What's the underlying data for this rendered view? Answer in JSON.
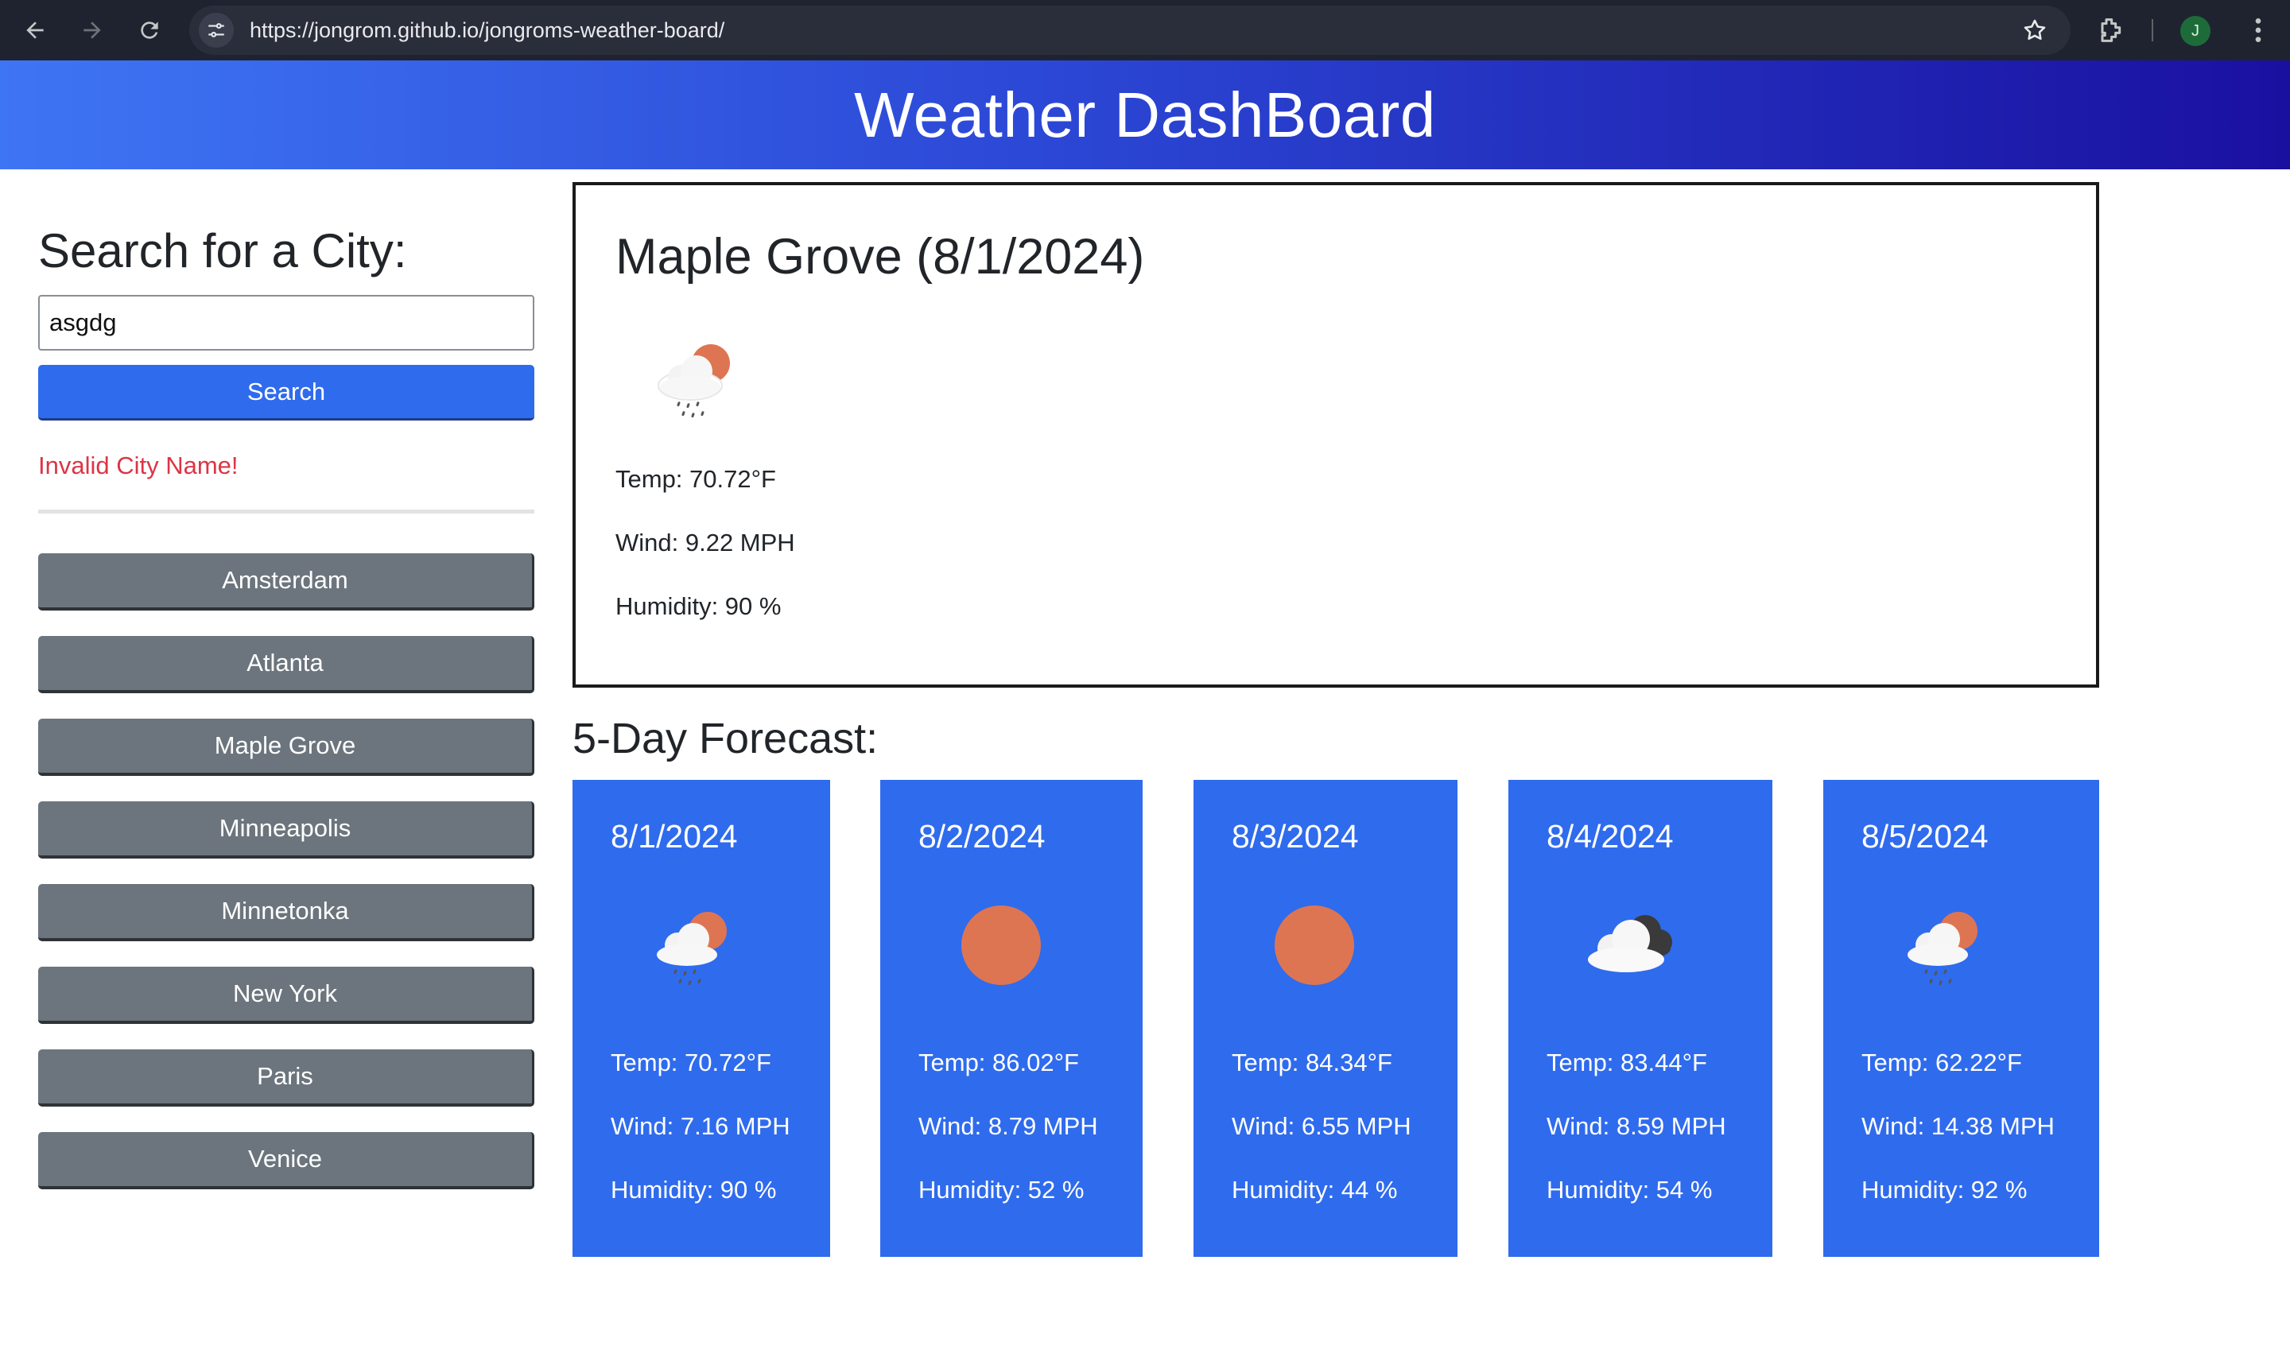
{
  "browser": {
    "url": "https://jongrom.github.io/jongroms-weather-board/",
    "profile_initial": "J"
  },
  "header": {
    "title": "Weather DashBoard"
  },
  "sidebar": {
    "search_title": "Search for a City:",
    "search_value": "asgdg",
    "search_button": "Search",
    "error_message": "Invalid City Name!",
    "history": [
      "Amsterdam",
      "Atlanta",
      "Maple Grove",
      "Minneapolis",
      "Minnetonka",
      "New York",
      "Paris",
      "Venice"
    ]
  },
  "current": {
    "title": "Maple Grove (8/1/2024)",
    "icon": "rain-sun-icon",
    "temp": "Temp: 70.72°F",
    "wind": "Wind: 9.22 MPH",
    "humidity": "Humidity: 90 %"
  },
  "forecast": {
    "title": "5-Day Forecast:",
    "days": [
      {
        "date": "8/1/2024",
        "icon": "rain-sun-icon",
        "temp": "Temp: 70.72°F",
        "wind": "Wind: 7.16 MPH",
        "humidity": "Humidity: 90 %"
      },
      {
        "date": "8/2/2024",
        "icon": "sun-icon",
        "temp": "Temp: 86.02°F",
        "wind": "Wind: 8.79 MPH",
        "humidity": "Humidity: 52 %"
      },
      {
        "date": "8/3/2024",
        "icon": "sun-icon",
        "temp": "Temp: 84.34°F",
        "wind": "Wind: 6.55 MPH",
        "humidity": "Humidity: 44 %"
      },
      {
        "date": "8/4/2024",
        "icon": "cloud-icon",
        "temp": "Temp: 83.44°F",
        "wind": "Wind: 8.59 MPH",
        "humidity": "Humidity: 54 %"
      },
      {
        "date": "8/5/2024",
        "icon": "rain-sun-icon",
        "temp": "Temp: 62.22°F",
        "wind": "Wind: 14.38 MPH",
        "humidity": "Humidity: 92 %"
      }
    ]
  },
  "colors": {
    "accent_blue": "#2f6bed",
    "history_gray": "#6c757d",
    "error_red": "#dc3545",
    "sun_orange": "#de7552"
  }
}
